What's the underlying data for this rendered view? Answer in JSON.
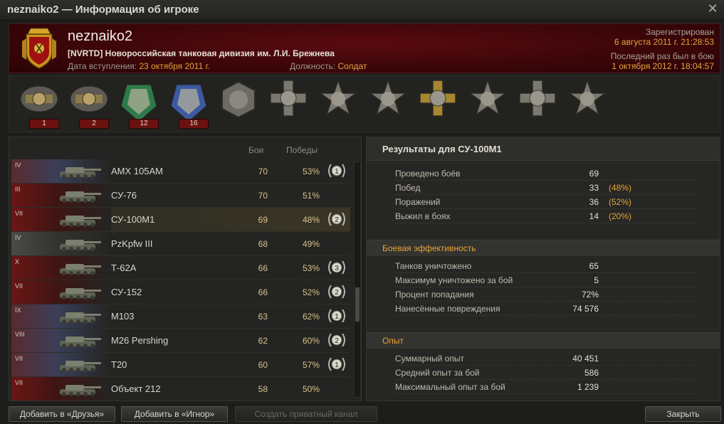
{
  "window": {
    "title": "neznaiko2 — Информация об игроке",
    "close_icon": "close-icon"
  },
  "header": {
    "player_name": "neznaiko2",
    "clan_tag": "[NVRTD]",
    "clan_name": "Новороссийская танковая дивизия им. Л.И. Брежнева",
    "joined_label": "Дата вступления:",
    "joined_value": "23 октября 2011 г.",
    "position_label": "Должность:",
    "position_value": "Солдат",
    "registered_label": "Зарегистрирован",
    "registered_value": "6 августа 2011 г. 21:28:53",
    "last_seen_label": "Последний раз был в бою",
    "last_seen_value": "1 октября 2012 г. 18:04:57",
    "emblem_icon": "clan-emblem-icon"
  },
  "medals": [
    {
      "icon": "ace-tanker-badge-icon",
      "count": "1"
    },
    {
      "icon": "first-class-badge-icon",
      "count": "2"
    },
    {
      "icon": "warrior-medal-icon",
      "count": "12"
    },
    {
      "icon": "defender-medal-icon",
      "count": "16"
    },
    {
      "icon": "hexagon-medal-icon",
      "count": ""
    },
    {
      "icon": "cross-medal-icon",
      "count": ""
    },
    {
      "icon": "star-medal-icon",
      "count": ""
    },
    {
      "icon": "star-medal-icon",
      "count": ""
    },
    {
      "icon": "gold-cross-medal-icon",
      "count": ""
    },
    {
      "icon": "star-medal-icon",
      "count": ""
    },
    {
      "icon": "cross-medal-icon",
      "count": ""
    },
    {
      "icon": "star-medal-icon",
      "count": ""
    }
  ],
  "tank_table": {
    "col_battles": "Бои",
    "col_wins": "Победы",
    "rows": [
      {
        "tier": "IV",
        "name": "AMX 105AM",
        "battles": "70",
        "wins": "53%",
        "mastery": "1",
        "flag": "usa",
        "selected": false
      },
      {
        "tier": "III",
        "name": "СУ-76",
        "battles": "70",
        "wins": "51%",
        "mastery": "",
        "flag": "ussr",
        "selected": false
      },
      {
        "tier": "VII",
        "name": "СУ-100М1",
        "battles": "69",
        "wins": "48%",
        "mastery": "2",
        "flag": "ussr",
        "selected": true
      },
      {
        "tier": "IV",
        "name": "PzKpfw III",
        "battles": "68",
        "wins": "49%",
        "mastery": "",
        "flag": "germany",
        "selected": false
      },
      {
        "tier": "X",
        "name": "Т-62А",
        "battles": "66",
        "wins": "53%",
        "mastery": "3",
        "flag": "ussr",
        "selected": false
      },
      {
        "tier": "VII",
        "name": "СУ-152",
        "battles": "66",
        "wins": "52%",
        "mastery": "2",
        "flag": "ussr",
        "selected": false
      },
      {
        "tier": "IX",
        "name": "M103",
        "battles": "63",
        "wins": "62%",
        "mastery": "1",
        "flag": "usa",
        "selected": false
      },
      {
        "tier": "VIII",
        "name": "M26 Pershing",
        "battles": "62",
        "wins": "60%",
        "mastery": "2",
        "flag": "usa",
        "selected": false
      },
      {
        "tier": "VII",
        "name": "T20",
        "battles": "60",
        "wins": "57%",
        "mastery": "1",
        "flag": "usa",
        "selected": false
      },
      {
        "tier": "VII",
        "name": "Объект 212",
        "battles": "58",
        "wins": "50%",
        "mastery": "",
        "flag": "ussr",
        "selected": false
      }
    ]
  },
  "stats": {
    "title": "Результаты для СУ-100М1",
    "general": [
      {
        "label": "Проведено боёв",
        "value": "69",
        "pct": ""
      },
      {
        "label": "Побед",
        "value": "33",
        "pct": "(48%)"
      },
      {
        "label": "Поражений",
        "value": "36",
        "pct": "(52%)"
      },
      {
        "label": "Выжил в боях",
        "value": "14",
        "pct": "(20%)"
      }
    ],
    "combat_title": "Боевая эффективность",
    "combat": [
      {
        "label": "Танков уничтожено",
        "value": "65",
        "pct": ""
      },
      {
        "label": "Максимум уничтожено за бой",
        "value": "5",
        "pct": ""
      },
      {
        "label": "Процент попадания",
        "value": "72%",
        "pct": ""
      },
      {
        "label": "Нанесённые повреждения",
        "value": "74 576",
        "pct": ""
      }
    ],
    "xp_title": "Опыт",
    "xp": [
      {
        "label": "Суммарный опыт",
        "value": "40 451",
        "pct": ""
      },
      {
        "label": "Средний опыт за бой",
        "value": "586",
        "pct": ""
      },
      {
        "label": "Максимальный опыт за бой",
        "value": "1 239",
        "pct": ""
      }
    ]
  },
  "footer": {
    "add_friend": "Добавить в «Друзья»",
    "add_ignore": "Добавить в «Игнор»",
    "private_channel": "Создать приватный канал",
    "close": "Закрыть"
  },
  "colors": {
    "accent": "#e5a43a",
    "header_red": "#4a070b",
    "counter_red": "#6b1210"
  }
}
